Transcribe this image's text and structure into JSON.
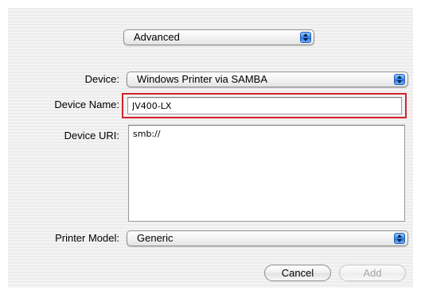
{
  "mode_popup": {
    "value": "Advanced"
  },
  "device": {
    "label": "Device:",
    "value": "Windows Printer via SAMBA"
  },
  "device_name": {
    "label": "Device Name:",
    "value": "JV400-LX"
  },
  "device_uri": {
    "label": "Device URI:",
    "value": "smb://"
  },
  "printer_model": {
    "label": "Printer Model:",
    "value": "Generic"
  },
  "buttons": {
    "cancel": "Cancel",
    "add": "Add"
  },
  "colors": {
    "highlight": "#d2232a",
    "stepper": "#3b8ef0"
  }
}
